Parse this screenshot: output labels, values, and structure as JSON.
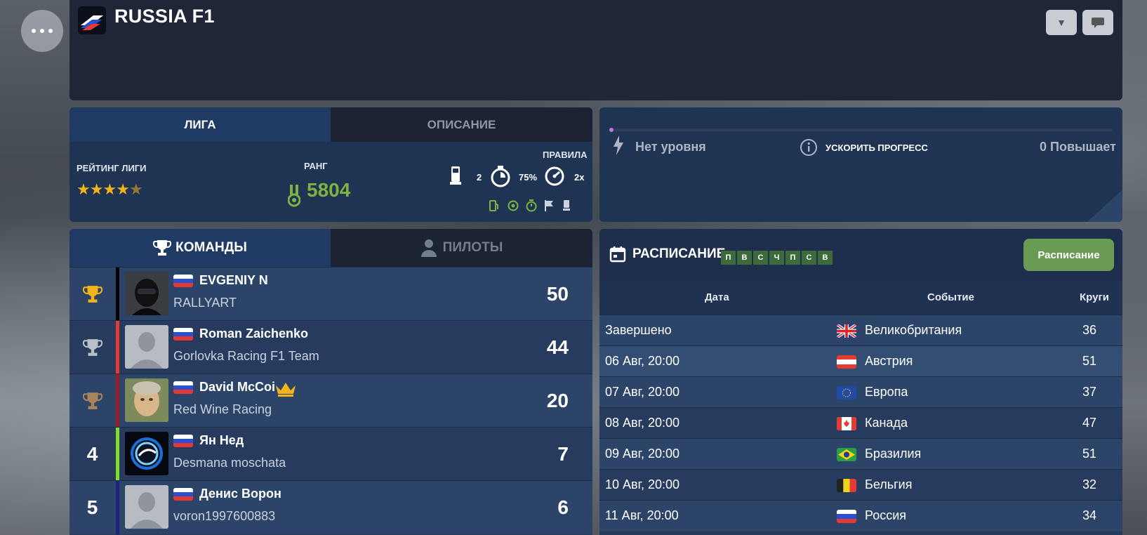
{
  "header": {
    "title": "RUSSIA F1"
  },
  "league": {
    "tabs": [
      {
        "label": "ЛИГА"
      },
      {
        "label": "ОПИСАНИЕ"
      }
    ],
    "rating_label": "РЕЙТИНГ ЛИГИ",
    "rating_stars": 4.5,
    "rank_label": "РАНГ",
    "rank_value": "5804",
    "rules_label": "ПРАВИЛА",
    "rules": {
      "fuel_value": "2",
      "tyre_value": "75%",
      "speed_value": "2x"
    }
  },
  "progress": {
    "level_text": "Нет уровня",
    "boost_text": "УСКОРИТЬ ПРОГРЕСС",
    "boosts_text": "0 Повышает",
    "progress_fraction": 0.005,
    "accent_color": "#c07ad8"
  },
  "standings": {
    "tabs": [
      {
        "label": "КОМАНДЫ"
      },
      {
        "label": "ПИЛОТЫ"
      }
    ],
    "rows": [
      {
        "pos": "",
        "driver": "EVGENIY N",
        "team": "RALLYART",
        "points": "50",
        "stripe": "#000000",
        "trophy": "gold"
      },
      {
        "pos": "",
        "driver": "Roman Zaichenko",
        "team": "Gorlovka Racing F1 Team",
        "points": "44",
        "stripe": "#e53935",
        "trophy": "silver"
      },
      {
        "pos": "",
        "driver": "David McCoi",
        "team": "Red Wine Racing",
        "points": "20",
        "stripe": "#9c1c27",
        "trophy": "bronze"
      },
      {
        "pos": "4",
        "driver": "Ян Нед",
        "team": "Desmana moschata",
        "points": "7",
        "stripe": "#7ee02a",
        "trophy": ""
      },
      {
        "pos": "5",
        "driver": "Денис Ворон",
        "team": "voron1997600883",
        "points": "6",
        "stripe": "#1a237e",
        "trophy": ""
      }
    ]
  },
  "schedule": {
    "title": "РАСПИСАНИЕ",
    "days": [
      "П",
      "В",
      "С",
      "Ч",
      "П",
      "С",
      "В"
    ],
    "button_label": "Расписание",
    "columns": {
      "date": "Дата",
      "event": "Событие",
      "laps": "Круги"
    },
    "rows": [
      {
        "date": "Завершено",
        "event": "Великобритания",
        "laps": "36",
        "flag": "gb"
      },
      {
        "date": "06 Авг, 20:00",
        "event": "Австрия",
        "laps": "51",
        "flag": "at"
      },
      {
        "date": "07 Авг, 20:00",
        "event": "Европа",
        "laps": "37",
        "flag": "eu"
      },
      {
        "date": "08 Авг, 20:00",
        "event": "Канада",
        "laps": "47",
        "flag": "ca"
      },
      {
        "date": "09 Авг, 20:00",
        "event": "Бразилия",
        "laps": "51",
        "flag": "br"
      },
      {
        "date": "10 Авг, 20:00",
        "event": "Бельгия",
        "laps": "32",
        "flag": "be"
      },
      {
        "date": "11 Авг, 20:00",
        "event": "Россия",
        "laps": "34",
        "flag": "ru"
      }
    ]
  }
}
